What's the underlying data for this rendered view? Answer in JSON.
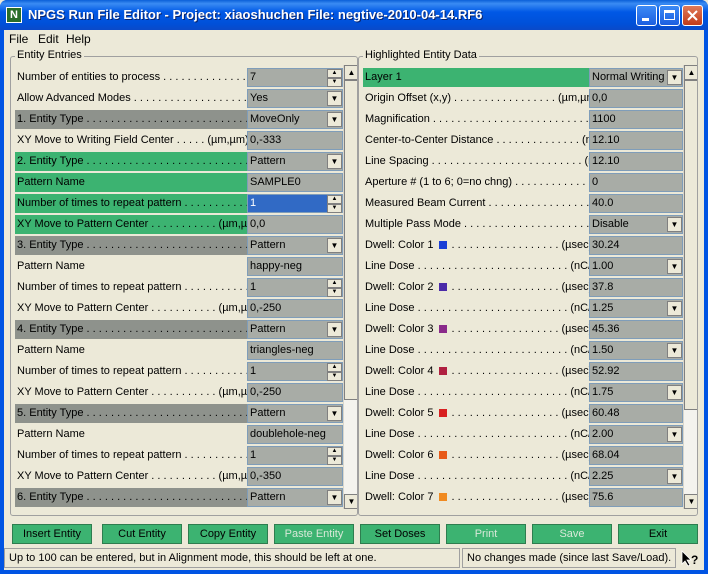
{
  "window": {
    "title": "NPGS Run File Editor - Project: xiaoshuchen  File: negtive-2010-04-14.RF6",
    "icon_letter": "N"
  },
  "menu": [
    {
      "label": "File"
    },
    {
      "label": "Edit"
    },
    {
      "label": "Help"
    }
  ],
  "entity_entries": {
    "title": "Entity Entries",
    "rows": [
      {
        "label": "Number of entities to process . . . . . . . . . . . . . . . .",
        "value": "7",
        "control": "spin"
      },
      {
        "label": "Allow Advanced Modes . . . . . . . . . . . . . . . . . . . . . . .",
        "value": "Yes",
        "control": "dropdown"
      },
      {
        "label": "1. Entity Type . . . . . . . . . . . . . . . . . . . . . . . . . . . . . . .",
        "value": "MoveOnly",
        "control": "dropdown"
      },
      {
        "label": "XY Move to Writing Field Center . . . . . (µm,µm)",
        "value": "0,-333",
        "control": "text"
      },
      {
        "label": "2. Entity Type . . . . . . . . . . . . . . . . . . . . . . . . . . . . . . .",
        "value": "Pattern",
        "control": "dropdown"
      },
      {
        "label": "Pattern Name",
        "value": "SAMPLE0",
        "control": "text"
      },
      {
        "label": "Number of times to repeat pattern . . . . . . . . . . . . . .",
        "value": "1",
        "control": "spin"
      },
      {
        "label": "XY Move to Pattern Center . . . . . . . . . . . (µm,µm)",
        "value": "0,0",
        "control": "text"
      },
      {
        "label": "3. Entity Type . . . . . . . . . . . . . . . . . . . . . . . . . . . . . . .",
        "value": "Pattern",
        "control": "dropdown"
      },
      {
        "label": "Pattern Name",
        "value": "happy-neg",
        "control": "text"
      },
      {
        "label": "Number of times to repeat pattern . . . . . . . . . . . . . .",
        "value": "1",
        "control": "spin"
      },
      {
        "label": "XY Move to Pattern Center . . . . . . . . . . . (µm,µm)",
        "value": "0,-250",
        "control": "text"
      },
      {
        "label": "4. Entity Type . . . . . . . . . . . . . . . . . . . . . . . . . . . . . . .",
        "value": "Pattern",
        "control": "dropdown"
      },
      {
        "label": "Pattern Name",
        "value": "triangles-neg",
        "control": "text"
      },
      {
        "label": "Number of times to repeat pattern . . . . . . . . . . . . . .",
        "value": "1",
        "control": "spin"
      },
      {
        "label": "XY Move to Pattern Center . . . . . . . . . . . (µm,µm)",
        "value": "0,-250",
        "control": "text"
      },
      {
        "label": "5. Entity Type . . . . . . . . . . . . . . . . . . . . . . . . . . . . . . .",
        "value": "Pattern",
        "control": "dropdown"
      },
      {
        "label": "Pattern Name",
        "value": "doublehole-neg",
        "control": "text"
      },
      {
        "label": "Number of times to repeat pattern . . . . . . . . . . . . . .",
        "value": "1",
        "control": "spin"
      },
      {
        "label": "XY Move to Pattern Center . . . . . . . . . . . (µm,µm)",
        "value": "0,-350",
        "control": "text"
      },
      {
        "label": "6. Entity Type . . . . . . . . . . . . . . . . . . . . . . . . . . . . . . .",
        "value": "Pattern",
        "control": "dropdown"
      }
    ]
  },
  "highlighted": {
    "title": "Highlighted Entity Data",
    "rows": [
      {
        "label": "Layer  1",
        "value": "Normal Writing",
        "control": "dropdown"
      },
      {
        "label": "Origin Offset (x,y) . . . . . . . . . . . . . . . . . (µm,µm)",
        "value": "0,0",
        "control": "text"
      },
      {
        "label": "Magnification . . . . . . . . . . . . . . . . . . . . . . . . . . . .",
        "value": "1100",
        "control": "text"
      },
      {
        "label": "Center-to-Center Distance . . . . . . . . . . . . . . (nm)",
        "value": "12.10",
        "control": "text"
      },
      {
        "label": "Line Spacing . . . . . . . . . . . . . . . . . . . . . . . . . (nm)",
        "value": "12.10",
        "control": "text"
      },
      {
        "label": "Aperture # (1 to 6; 0=no chng) . . . . . . . . . . . . . .",
        "value": "0",
        "control": "text"
      },
      {
        "label": "Measured Beam Current . . . . . . . . . . . . . . . . . (pA)",
        "value": "40.0",
        "control": "text"
      },
      {
        "label": "Multiple Pass Mode . . . . . . . . . . . . . . . . . . . . . .",
        "value": "Disable",
        "control": "dropdown"
      },
      {
        "label": "Dwell: Color 1",
        "swatch": "#1a3fd6",
        "tail": ". . . . . . . . . . . . . . . . . . (µsec)",
        "value": "30.24",
        "control": "text"
      },
      {
        "label": "   Line Dose . . . . . . . . . . . . . . . . . . . . . . . . . (nC/cm)",
        "value": "1.00",
        "control": "dropdown"
      },
      {
        "label": "Dwell: Color 2",
        "swatch": "#4a2aa8",
        "tail": ". . . . . . . . . . . . . . . . . . (µsec)",
        "value": "37.8",
        "control": "text"
      },
      {
        "label": "   Line Dose . . . . . . . . . . . . . . . . . . . . . . . . . (nC/cm)",
        "value": "1.25",
        "control": "dropdown"
      },
      {
        "label": "Dwell: Color 3",
        "swatch": "#8a2a8a",
        "tail": ". . . . . . . . . . . . . . . . . . (µsec)",
        "value": "45.36",
        "control": "text"
      },
      {
        "label": "   Line Dose . . . . . . . . . . . . . . . . . . . . . . . . . (nC/cm)",
        "value": "1.50",
        "control": "dropdown"
      },
      {
        "label": "Dwell: Color 4",
        "swatch": "#b02040",
        "tail": ". . . . . . . . . . . . . . . . . . (µsec)",
        "value": "52.92",
        "control": "text"
      },
      {
        "label": "   Line Dose . . . . . . . . . . . . . . . . . . . . . . . . . (nC/cm)",
        "value": "1.75",
        "control": "dropdown"
      },
      {
        "label": "Dwell: Color 5",
        "swatch": "#d82020",
        "tail": ". . . . . . . . . . . . . . . . . . (µsec)",
        "value": "60.48",
        "control": "text"
      },
      {
        "label": "   Line Dose . . . . . . . . . . . . . . . . . . . . . . . . . (nC/cm)",
        "value": "2.00",
        "control": "dropdown"
      },
      {
        "label": "Dwell: Color 6",
        "swatch": "#e85a18",
        "tail": ". . . . . . . . . . . . . . . . . . (µsec)",
        "value": "68.04",
        "control": "text"
      },
      {
        "label": "   Line Dose . . . . . . . . . . . . . . . . . . . . . . . . . (nC/cm)",
        "value": "2.25",
        "control": "dropdown"
      },
      {
        "label": "Dwell: Color 7",
        "swatch": "#f08a20",
        "tail": ". . . . . . . . . . . . . . . . . . (µsec)",
        "value": "75.6",
        "control": "text"
      }
    ]
  },
  "buttons": [
    {
      "label": "Insert Entity",
      "enabled": true
    },
    {
      "label": "Cut Entity",
      "enabled": true
    },
    {
      "label": "Copy Entity",
      "enabled": true
    },
    {
      "label": "Paste Entity",
      "enabled": false
    },
    {
      "label": "Set Doses",
      "enabled": true
    },
    {
      "label": "Print",
      "enabled": false
    },
    {
      "label": "Save",
      "enabled": false
    },
    {
      "label": "Exit",
      "enabled": true
    }
  ],
  "status": {
    "left": "Up to 100 can be entered, but in Alignment mode, this should be left at one.",
    "right": "No changes made (since last Save/Load)."
  },
  "colors": {
    "title_bar": "#0054e3",
    "highlight_green": "#3cb371",
    "field_gray": "#a8aca6",
    "selection_blue": "#316ac5"
  }
}
